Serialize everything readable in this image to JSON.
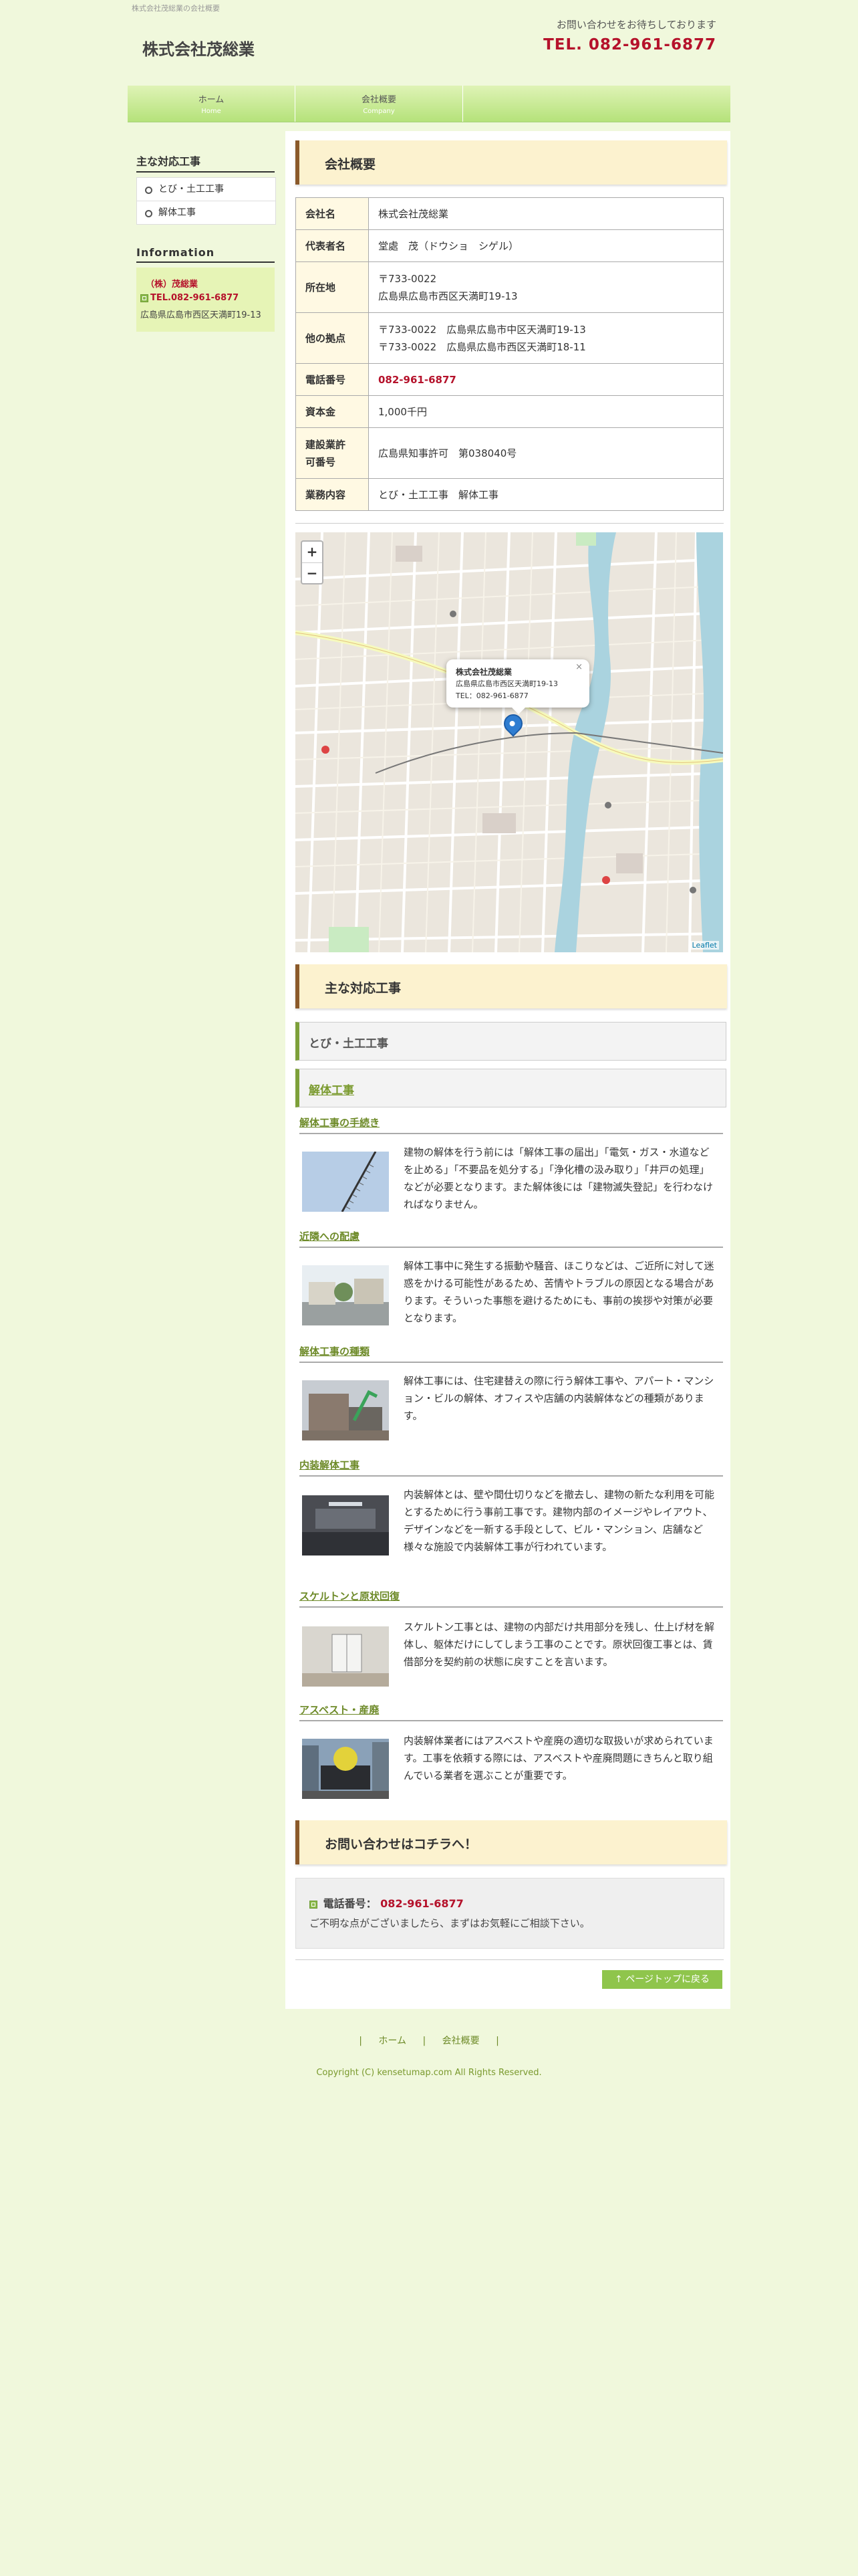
{
  "header": {
    "tagline": "株式会社茂総業の会社概要",
    "site_title": "株式会社茂総業",
    "contact_msg": "お問い合わせをお待ちしております",
    "contact_tel": "TEL. 082-961-6877"
  },
  "nav": {
    "items": [
      {
        "label": "ホーム",
        "sub": "Home"
      },
      {
        "label": "会社概要",
        "sub": "Company"
      }
    ]
  },
  "sidebar": {
    "works_title": "主な対応工事",
    "works": [
      "とび・土工工事",
      "解体工事"
    ],
    "info_title": "Information",
    "info_name": "（株）茂総業",
    "info_tel": "TEL.082-961-6877",
    "info_addr": "広島県広島市西区天満町19-13"
  },
  "company": {
    "heading": "会社概要",
    "rows": [
      {
        "key": "会社名",
        "value": "株式会社茂総業"
      },
      {
        "key": "代表者名",
        "value": "堂處　茂（ドウショ　シゲル）"
      },
      {
        "key": "所在地",
        "value1": "〒733-0022",
        "value2": "広島県広島市西区天満町19-13"
      },
      {
        "key": "他の拠点",
        "value1": "〒733-0022　広島県広島市中区天満町19-13",
        "value2": "〒733-0022　広島県広島市西区天満町18-11"
      },
      {
        "key": "電話番号",
        "value": "082-961-6877"
      },
      {
        "key": "資本金",
        "value": "1,000千円"
      },
      {
        "key1": "建設業許",
        "key2": "可番号",
        "value": "広島県知事許可　第038040号"
      },
      {
        "key": "業務内容",
        "value": "とび・土工工事　解体工事"
      }
    ]
  },
  "map": {
    "zoom_in": "+",
    "zoom_out": "−",
    "popup_name": "株式会社茂総業",
    "popup_addr": "広島県広島市西区天満町19-13",
    "popup_tel": "TEL：082-961-6877",
    "popup_close": "×",
    "attribution": "Leaflet"
  },
  "works": {
    "heading": "主な対応工事",
    "cat1": "とび・土工工事",
    "cat2": "解体工事",
    "items": [
      {
        "title": "解体工事の手続き",
        "text": "建物の解体を行う前には「解体工事の届出」「電気・ガス・水道などを止める」「不要品を処分する」「浄化槽の汲み取り」「井戸の処理」などが必要となります。また解体後には「建物滅失登記」を行わなければなりません。"
      },
      {
        "title": "近隣への配慮",
        "text": "解体工事中に発生する振動や騒音、ほこりなどは、ご近所に対して迷惑をかける可能性があるため、苦情やトラブルの原因となる場合があります。そういった事態を避けるためにも、事前の挨拶や対策が必要となります。"
      },
      {
        "title": "解体工事の種類",
        "text": "解体工事には、住宅建替えの際に行う解体工事や、アパート・マンション・ビルの解体、オフィスや店舗の内装解体などの種類があります。"
      },
      {
        "title": "内装解体工事",
        "text": "内装解体とは、壁や間仕切りなどを撤去し、建物の新たな利用を可能とするために行う事前工事です。建物内部のイメージやレイアウト、デザインなどを一新する手段として、ビル・マンション、店舗など様々な施設で内装解体工事が行われています。"
      },
      {
        "title": "スケルトンと原状回復",
        "text": "スケルトン工事とは、建物の内部だけ共用部分を残し、仕上げ材を解体し、躯体だけにしてしまう工事のことです。原状回復工事とは、賃借部分を契約前の状態に戻すことを言います。"
      },
      {
        "title": "アスベスト・産廃",
        "text": "内装解体業者にはアスベストや産廃の適切な取扱いが求められています。工事を依頼する際には、アスベストや産廃問題にきちんと取り組んでいる業者を選ぶことが重要です。"
      }
    ]
  },
  "inquiry": {
    "heading": "お問い合わせはコチラへ！",
    "tel_label": "電話番号：",
    "tel": "082-961-6877",
    "note": "ご不明な点がございましたら、まずはお気軽にご相談下さい。"
  },
  "to_top": "↑ ページトップに戻る",
  "footer": {
    "links": [
      "ホーム",
      "会社概要"
    ],
    "sep": "|",
    "copyright": "Copyright (C) kensetumap.com All Rights Reserved."
  }
}
